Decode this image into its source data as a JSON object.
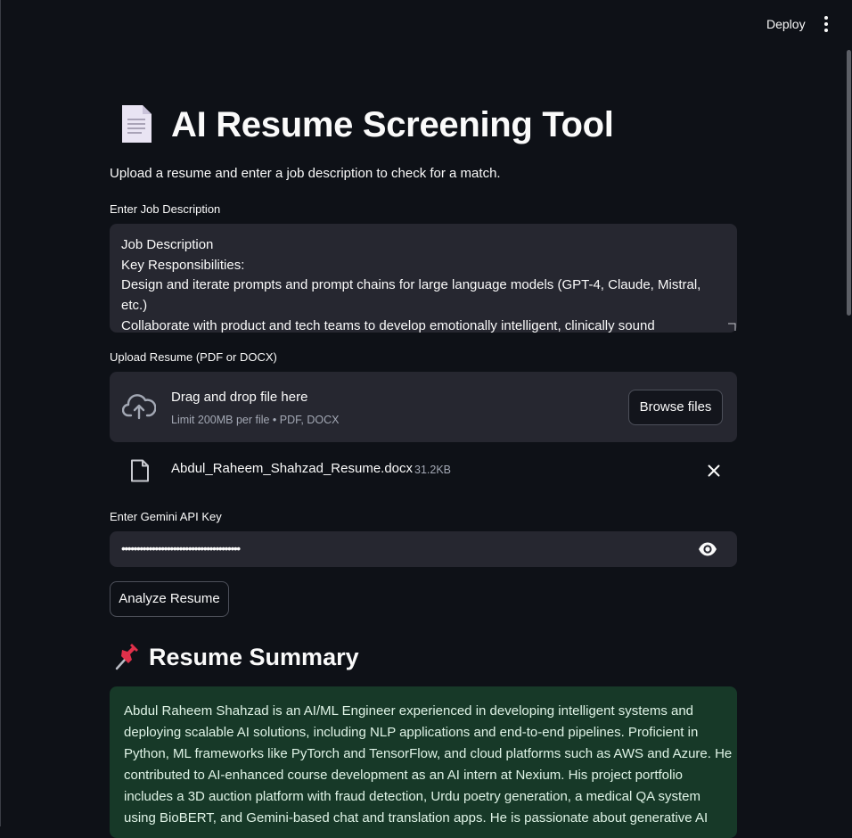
{
  "header": {
    "deploy_label": "Deploy"
  },
  "title": "AI Resume Screening Tool",
  "subtitle": "Upload a resume and enter a job description to check for a match.",
  "job_description": {
    "label": "Enter Job Description",
    "lines": [
      "Job Description",
      "Key Responsibilities:",
      "Design and iterate prompts and prompt chains for large language models (GPT-4, Claude, Mistral,",
      "etc.)",
      "Collaborate with product and tech teams to develop emotionally intelligent, clinically sound"
    ]
  },
  "upload": {
    "label": "Upload Resume (PDF or DOCX)",
    "dropzone_title": "Drag and drop file here",
    "dropzone_limit": "Limit 200MB per file • PDF, DOCX",
    "browse_label": "Browse files",
    "file": {
      "name": "Abdul_Raheem_Shahzad_Resume.docx",
      "size": "31.2KB"
    }
  },
  "api_key": {
    "label": "Enter Gemini API Key",
    "masked_value": "•••••••••••••••••••••••••••••••••••••••"
  },
  "analyze_label": "Analyze Resume",
  "summary": {
    "heading": "Resume Summary",
    "lines": [
      "Abdul Raheem Shahzad is an AI/ML Engineer experienced in developing intelligent systems and",
      "deploying scalable AI solutions, including NLP applications and end-to-end pipelines. Proficient in",
      "Python, ML frameworks like PyTorch and TensorFlow, and cloud platforms such as AWS and Azure. He",
      "contributed to AI-enhanced course development as an AI intern at Nexium. His project portfolio",
      "includes a 3D auction platform with fraud detection, Urdu poetry generation, a medical QA system",
      "using BioBERT, and Gemini-based chat and translation apps. He is passionate about generative AI"
    ]
  },
  "colors": {
    "background": "#0e1117",
    "input_background": "#262730",
    "summary_background": "#173928",
    "summary_text": "#dff3e6"
  },
  "icons": [
    "document-icon",
    "kebab-menu-icon",
    "cloud-upload-icon",
    "file-icon",
    "close-icon",
    "eye-icon",
    "pushpin-icon"
  ]
}
